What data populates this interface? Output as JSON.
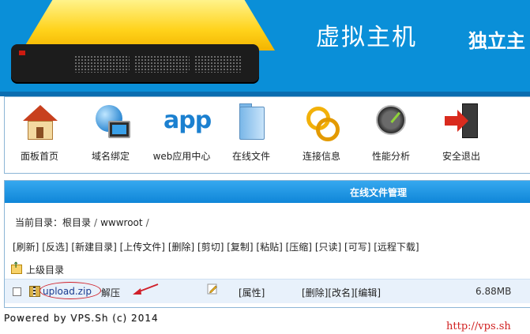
{
  "header": {
    "title": "虚拟主机",
    "subtitle_fragment": "独立主",
    "accent_color": "#0a8fd8"
  },
  "nav": {
    "items": [
      {
        "label": "面板首页",
        "icon": "home-icon"
      },
      {
        "label": "域名绑定",
        "icon": "globe-monitor-icon"
      },
      {
        "label": "web应用中心",
        "icon": "app-icon"
      },
      {
        "label": "在线文件",
        "icon": "file-folder-icon"
      },
      {
        "label": "连接信息",
        "icon": "chain-link-icon"
      },
      {
        "label": "性能分析",
        "icon": "gauge-icon"
      },
      {
        "label": "安全退出",
        "icon": "exit-icon"
      }
    ]
  },
  "file_manager": {
    "title": "在线文件管理",
    "breadcrumb": {
      "prefix": "当前目录：",
      "root": "根目录",
      "dir": "wwwroot",
      "trailing": "/"
    },
    "toolbar": [
      "[刷新]",
      "[反选]",
      "[新建目录]",
      "[上传文件]",
      "[删除]",
      "[剪切]",
      "[复制]",
      "[粘贴]",
      "[压缩]",
      "[只读]",
      "[可写]",
      "[远程下载]"
    ],
    "parent_dir": "上级目录",
    "files": [
      {
        "name": "upload.zip",
        "extract": "解压",
        "props": "[属性]",
        "delete": "[删除]",
        "rename": "[改名]",
        "edit": "[编辑]",
        "size": "6.88MB"
      }
    ]
  },
  "footer": {
    "powered": "Powered by VPS.Sh (c) 2014",
    "url": "http://vps.sh"
  }
}
